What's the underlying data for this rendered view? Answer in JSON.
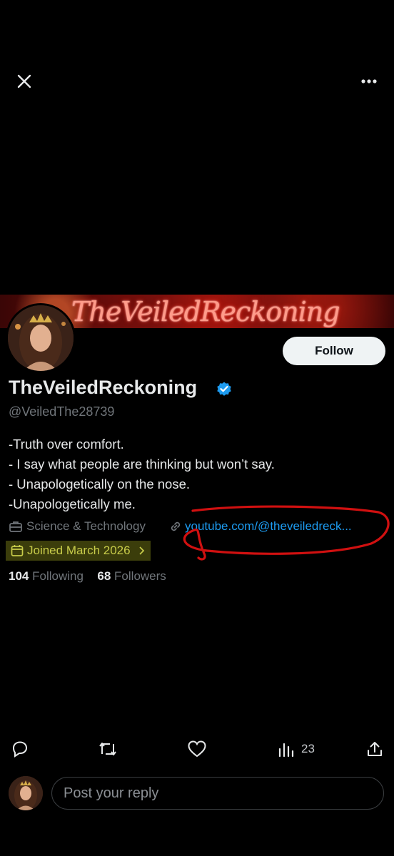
{
  "profile": {
    "banner_text": "TheVeiledReckoning",
    "display_name": "TheVeiledReckoning",
    "handle": "@VeiledThe28739",
    "follow_label": "Follow",
    "bio": [
      "-Truth over comfort.",
      "- I say what people are thinking but won’t say.",
      "- Unapologetically on the nose.",
      "-Unapologetically me."
    ],
    "category": "Science & Technology",
    "link": "youtube.com/@theveiledreck...",
    "joined": "Joined March 2026",
    "following_count": "104",
    "following_label": "Following",
    "followers_count": "68",
    "followers_label": "Followers"
  },
  "actions": {
    "views_count": "23"
  },
  "reply": {
    "placeholder": "Post your reply"
  },
  "colors": {
    "accent": "#1d9bf0",
    "highlight": "#d4dc28",
    "annotation": "#d01010",
    "verified": "#1d9bf0"
  },
  "icons": [
    "close-icon",
    "more-icon",
    "verified-icon",
    "briefcase-icon",
    "link-icon",
    "calendar-icon",
    "chevron-right-icon",
    "reply-icon",
    "repost-icon",
    "like-icon",
    "views-icon",
    "share-icon"
  ]
}
